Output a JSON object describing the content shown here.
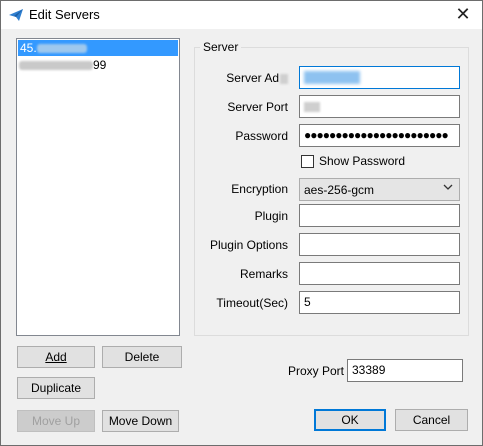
{
  "window": {
    "title": "Edit Servers",
    "close_glyph": "✕"
  },
  "server_list": {
    "items": [
      {
        "label": "45.",
        "selected": true
      },
      {
        "label": "99",
        "selected": false
      }
    ]
  },
  "list_buttons": {
    "add": "Add",
    "delete": "Delete",
    "duplicate": "Duplicate",
    "move_up": "Move Up",
    "move_down": "Move Down"
  },
  "server_group": {
    "title": "Server",
    "server_address_label": "Server Ad",
    "server_port_label": "Server Port",
    "password_label": "Password",
    "password_value": "●●●●●●●●●●●●●●●●●●●●●●●",
    "show_password_label": "Show Password",
    "show_password_checked": false,
    "encryption_label": "Encryption",
    "encryption_value": "aes-256-gcm",
    "plugin_label": "Plugin",
    "plugin_value": "",
    "plugin_options_label": "Plugin Options",
    "plugin_options_value": "",
    "remarks_label": "Remarks",
    "remarks_value": "",
    "timeout_label": "Timeout(Sec)",
    "timeout_value": "5"
  },
  "proxy": {
    "label": "Proxy Port",
    "value": "33389"
  },
  "dialog_buttons": {
    "ok": "OK",
    "cancel": "Cancel"
  },
  "colors": {
    "accent": "#0078d7",
    "selection": "#3399ff"
  },
  "icons": {
    "app": "paper-plane-icon",
    "close": "close-icon",
    "dropdown": "chevron-down-icon"
  }
}
